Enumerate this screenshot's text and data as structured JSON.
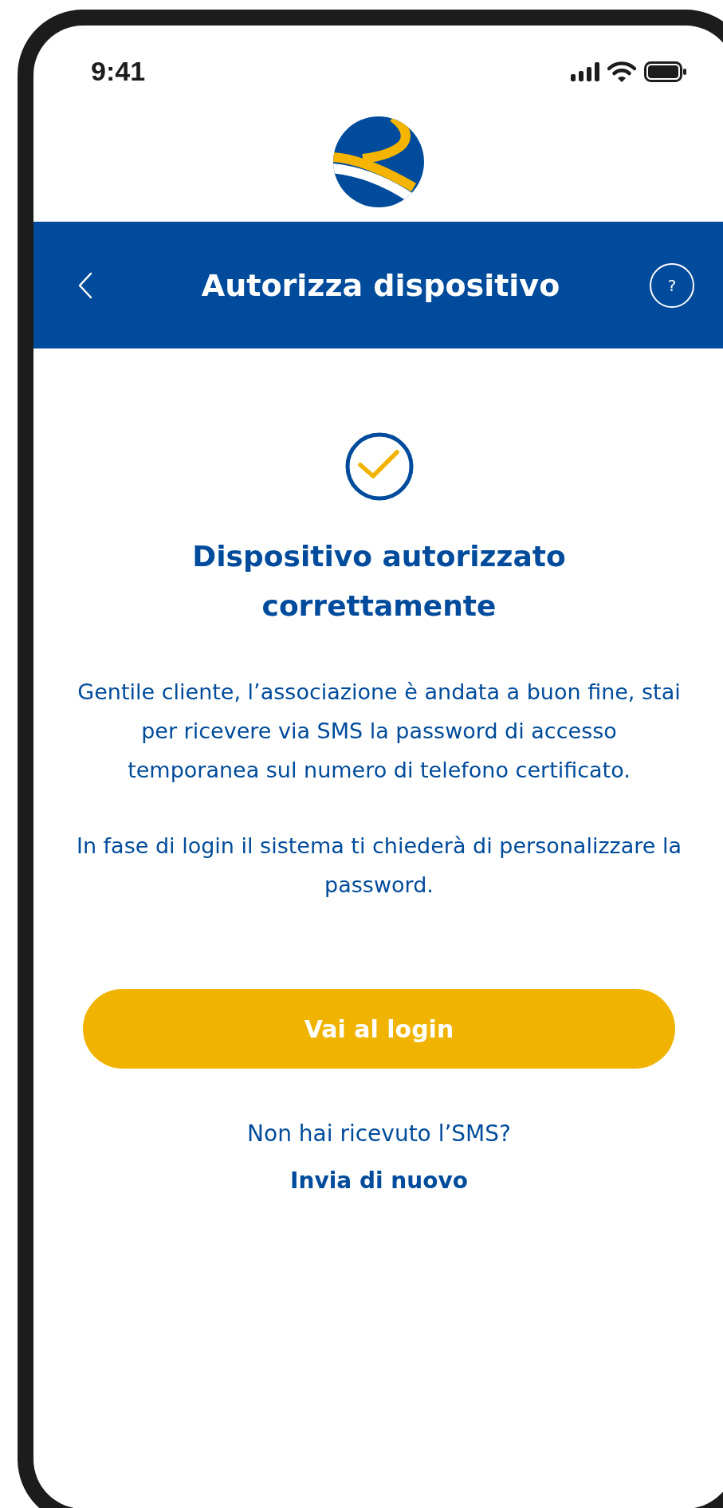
{
  "status_bar": {
    "time": "9:41"
  },
  "header": {
    "title": "Autorizza dispositivo",
    "help": "?"
  },
  "result": {
    "title": "Dispositivo autorizzato correttamente",
    "paragraphs": [
      "Gentile cliente, l’associazione è andata a buon fine, stai per ricevere via SMS la password di accesso temporanea sul numero di telefono certificato.",
      "In fase di login il sistema ti chiederà di personalizzare la password."
    ]
  },
  "primary_button": {
    "label": "Vai al login"
  },
  "resend": {
    "prompt": "Non hai ricevuto l’SMS?",
    "link": "Invia di nuovo"
  }
}
